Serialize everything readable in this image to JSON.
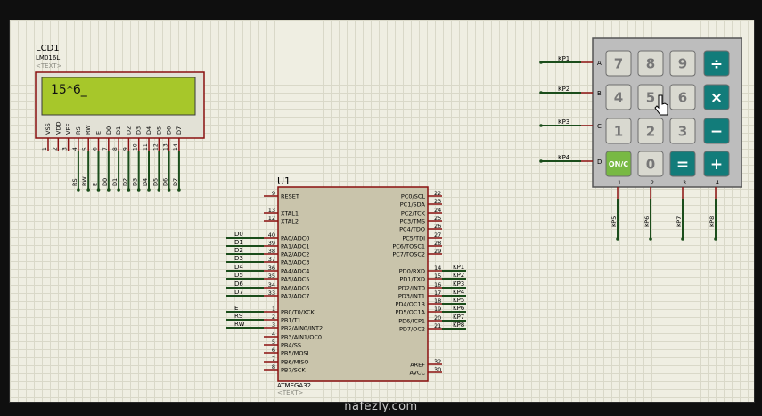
{
  "lcd": {
    "name": "LCD1",
    "model": "LM016L",
    "text_tag": "<TEXT>",
    "display_text": "15*6_",
    "pin_labels": [
      "VSS",
      "VDD",
      "VEE",
      "RS",
      "RW",
      "E",
      "D0",
      "D1",
      "D2",
      "D3",
      "D4",
      "D5",
      "D6",
      "D7"
    ],
    "pin_numbers": [
      "1",
      "2",
      "3",
      "4",
      "5",
      "6",
      "7",
      "8",
      "9",
      "10",
      "11",
      "12",
      "13",
      "14"
    ],
    "net_labels": [
      "RS",
      "RW",
      "E",
      "D0",
      "D1",
      "D2",
      "D3",
      "D4",
      "D5",
      "D6",
      "D7"
    ]
  },
  "mcu": {
    "name": "U1",
    "model": "ATMEGA32",
    "text_tag": "<TEXT>",
    "left_pins": [
      {
        "num": "9",
        "label": "RESET",
        "net": ""
      },
      {
        "num": "13",
        "label": "XTAL1",
        "net": ""
      },
      {
        "num": "12",
        "label": "XTAL2",
        "net": ""
      },
      {
        "num": "40",
        "label": "PA0/ADC0",
        "net": "D0"
      },
      {
        "num": "39",
        "label": "PA1/ADC1",
        "net": "D1"
      },
      {
        "num": "38",
        "label": "PA2/ADC2",
        "net": "D2"
      },
      {
        "num": "37",
        "label": "PA3/ADC3",
        "net": "D3"
      },
      {
        "num": "36",
        "label": "PA4/ADC4",
        "net": "D4"
      },
      {
        "num": "35",
        "label": "PA5/ADC5",
        "net": "D5"
      },
      {
        "num": "34",
        "label": "PA6/ADC6",
        "net": "D6"
      },
      {
        "num": "33",
        "label": "PA7/ADC7",
        "net": "D7"
      },
      {
        "num": "1",
        "label": "PB0/T0/XCK",
        "net": "E"
      },
      {
        "num": "2",
        "label": "PB1/T1",
        "net": "RS"
      },
      {
        "num": "3",
        "label": "PB2/AIN0/INT2",
        "net": "RW"
      },
      {
        "num": "4",
        "label": "PB3/AIN1/OC0",
        "net": ""
      },
      {
        "num": "5",
        "label": "PB4/SS",
        "net": ""
      },
      {
        "num": "6",
        "label": "PB5/MOSI",
        "net": ""
      },
      {
        "num": "7",
        "label": "PB6/MISO",
        "net": ""
      },
      {
        "num": "8",
        "label": "PB7/SCK",
        "net": ""
      }
    ],
    "right_pins": [
      {
        "num": "22",
        "label": "PC0/SCL",
        "net": ""
      },
      {
        "num": "23",
        "label": "PC1/SDA",
        "net": ""
      },
      {
        "num": "24",
        "label": "PC2/TCK",
        "net": ""
      },
      {
        "num": "25",
        "label": "PC3/TMS",
        "net": ""
      },
      {
        "num": "26",
        "label": "PC4/TDO",
        "net": ""
      },
      {
        "num": "27",
        "label": "PC5/TDI",
        "net": ""
      },
      {
        "num": "28",
        "label": "PC6/TOSC1",
        "net": ""
      },
      {
        "num": "29",
        "label": "PC7/TOSC2",
        "net": ""
      },
      {
        "num": "14",
        "label": "PD0/RXD",
        "net": "KP1"
      },
      {
        "num": "15",
        "label": "PD1/TXD",
        "net": "KP2"
      },
      {
        "num": "16",
        "label": "PD2/INT0",
        "net": "KP3"
      },
      {
        "num": "17",
        "label": "PD3/INT1",
        "net": "KP4"
      },
      {
        "num": "18",
        "label": "PD4/OC1B",
        "net": "KP5"
      },
      {
        "num": "19",
        "label": "PD5/OC1A",
        "net": "KP6"
      },
      {
        "num": "20",
        "label": "PD6/ICP1",
        "net": "KP7"
      },
      {
        "num": "21",
        "label": "PD7/OC2",
        "net": "KP8"
      },
      {
        "num": "32",
        "label": "AREF",
        "net": ""
      },
      {
        "num": "30",
        "label": "AVCC",
        "net": ""
      }
    ]
  },
  "keypad": {
    "row_nets": [
      "KP1",
      "KP2",
      "KP3",
      "KP4"
    ],
    "row_letters": [
      "A",
      "B",
      "C",
      "D"
    ],
    "col_numbers": [
      "1",
      "2",
      "3",
      "4"
    ],
    "col_nets": [
      "KP5",
      "KP6",
      "KP7",
      "KP8"
    ],
    "keys": [
      [
        "7",
        "8",
        "9",
        "÷"
      ],
      [
        "4",
        "5",
        "6",
        "×"
      ],
      [
        "1",
        "2",
        "3",
        "−"
      ],
      [
        "ON/C",
        "0",
        "=",
        "+"
      ]
    ]
  },
  "colors": {
    "canvas": "#efeee2",
    "wire": "#1b4d1b",
    "lcd_screen": "#a7c72a",
    "mcu_body": "#c9c4ab",
    "component_border": "#8a1010",
    "key_teal": "#127c7a",
    "key_gray": "#d9d9d0",
    "key_green": "#78b943"
  },
  "watermark": "nafezly.com"
}
